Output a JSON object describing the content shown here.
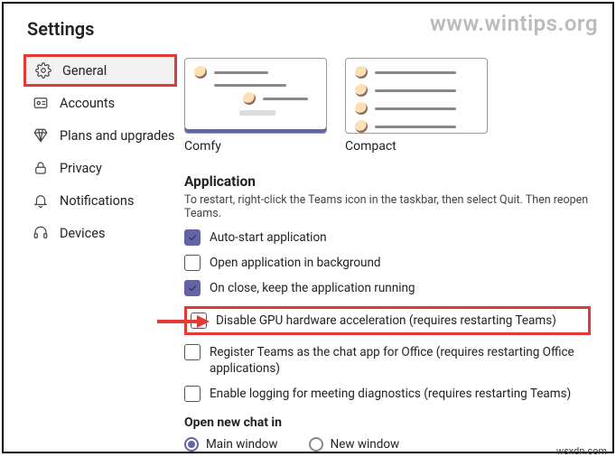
{
  "watermark": "www.wintips.org",
  "footer_tag": "wsxdn.com",
  "title": "Settings",
  "sidebar": {
    "items": [
      {
        "label": "General",
        "selected": true
      },
      {
        "label": "Accounts"
      },
      {
        "label": "Plans and upgrades"
      },
      {
        "label": "Privacy"
      },
      {
        "label": "Notifications"
      },
      {
        "label": "Devices"
      }
    ]
  },
  "layout_previews": {
    "comfy": "Comfy",
    "compact": "Compact"
  },
  "application": {
    "heading": "Application",
    "hint": "To restart, right-click the Teams icon in the taskbar, then select Quit. Then reopen Teams.",
    "options": [
      {
        "label": "Auto-start application",
        "checked": true
      },
      {
        "label": "Open application in background",
        "checked": false
      },
      {
        "label": "On close, keep the application running",
        "checked": true
      },
      {
        "label": "Disable GPU hardware acceleration (requires restarting Teams)",
        "checked": false,
        "highlight": true
      },
      {
        "label": "Register Teams as the chat app for Office (requires restarting Office applications)",
        "checked": false
      },
      {
        "label": "Enable logging for meeting diagnostics (requires restarting Teams)",
        "checked": false
      }
    ]
  },
  "open_chat": {
    "heading": "Open new chat in",
    "main_window": "Main window",
    "new_window": "New window"
  }
}
